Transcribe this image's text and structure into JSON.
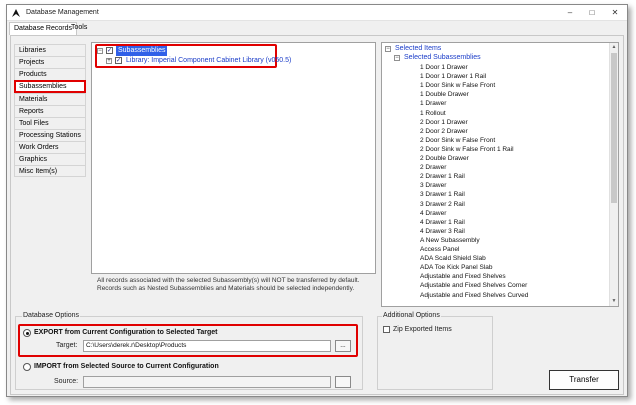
{
  "window": {
    "title": "Database Management",
    "controls": [
      "–",
      "□",
      "✕"
    ]
  },
  "tabs": [
    "Database Records",
    "Tools"
  ],
  "nav": {
    "items": [
      "Libraries",
      "Projects",
      "Products",
      "Subassemblies",
      "Materials",
      "Reports",
      "Tool Files",
      "Processing Stations",
      "Work Orders",
      "Graphics",
      "Misc Item(s)"
    ],
    "selected": "Subassemblies"
  },
  "tree": {
    "root_label": "Subassemblies",
    "child_label": "Library: Imperial Component Cabinet Library (v050.5)",
    "note": "All records associated with the selected Subassembly(s) will NOT be transferred by default. Records such as Nested Subassemblies and Materials should be selected independently."
  },
  "selected_items": {
    "header": "Selected Items",
    "group": "Selected Subassemblies",
    "items": [
      "1 Door 1 Drawer",
      "1 Door 1 Drawer 1 Rail",
      "1 Door Sink w False Front",
      "1 Double Drawer",
      "1 Drawer",
      "1 Rollout",
      "2 Door 1 Drawer",
      "2 Door 2 Drawer",
      "2 Door Sink w False Front",
      "2 Door Sink w False Front 1 Rail",
      "2 Double Drawer",
      "2 Drawer",
      "2 Drawer 1 Rail",
      "3 Drawer",
      "3 Drawer 1 Rail",
      "3 Drawer 2 Rail",
      "4 Drawer",
      "4 Drawer 1 Rail",
      "4 Drawer 3 Rail",
      "A New Subassembly",
      "Access Panel",
      "ADA Scald Shield Slab",
      "ADA Toe Kick Panel Slab",
      "Adjustable and Fixed Shelves",
      "Adjustable and Fixed Shelves Corner",
      "Adjustable and Fixed Shelves Curved"
    ]
  },
  "database_options": {
    "label": "Database Options",
    "export_label": "EXPORT from Current Configuration to Selected Target",
    "target_label": "Target:",
    "target_value": "C:\\Users\\derek.r\\Desktop\\Products",
    "import_label": "IMPORT from Selected Source to Current Configuration",
    "source_label": "Source:",
    "source_value": "",
    "browse": "..."
  },
  "additional_options": {
    "label": "Additional Options",
    "zip_label": "Zip Exported Items"
  },
  "transfer_label": "Transfer",
  "colors": {
    "highlight_red": "#e00000",
    "selection_blue": "#3060e8",
    "tree_text_blue": "#1a3cc8"
  }
}
